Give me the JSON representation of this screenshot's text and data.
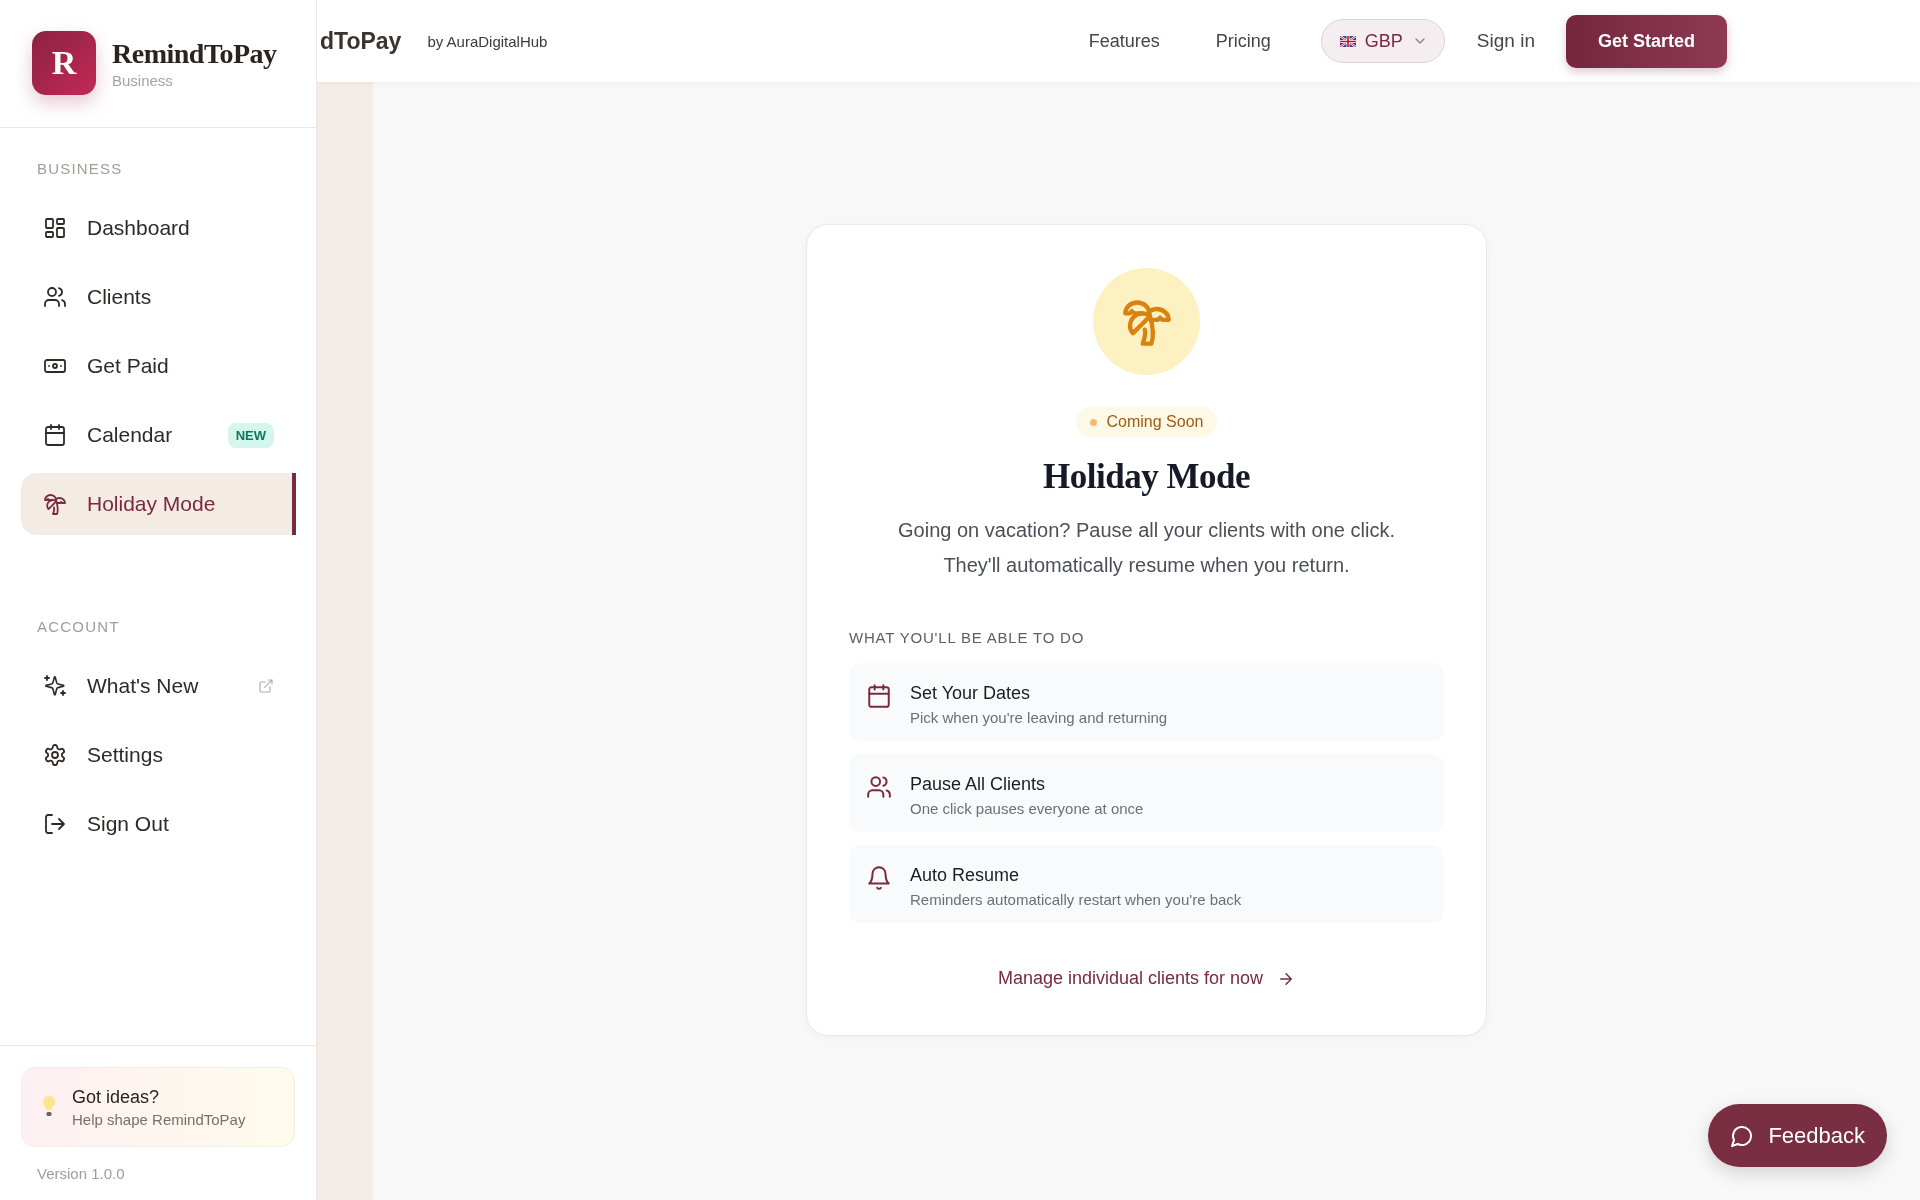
{
  "brand": {
    "logo_letter": "R",
    "name": "RemindToPay",
    "subtitle": "Business"
  },
  "sidebar": {
    "sections": [
      {
        "title": "BUSINESS",
        "items": [
          {
            "label": "Dashboard",
            "selected": false
          },
          {
            "label": "Clients",
            "selected": false
          },
          {
            "label": "Get Paid",
            "selected": false
          },
          {
            "label": "Calendar",
            "selected": false,
            "badge": "NEW"
          },
          {
            "label": "Holiday Mode",
            "selected": true
          }
        ]
      },
      {
        "title": "ACCOUNT",
        "items": [
          {
            "label": "What's New",
            "selected": false,
            "external": true
          },
          {
            "label": "Settings",
            "selected": false
          },
          {
            "label": "Sign Out",
            "selected": false
          }
        ]
      }
    ],
    "ideas": {
      "title": "Got ideas?",
      "subtitle": "Help shape RemindToPay"
    },
    "version": "Version 1.0.0"
  },
  "header": {
    "brand_fragment": "dToPay",
    "byline": "by AuraDigitalHub",
    "nav": [
      "Features",
      "Pricing"
    ],
    "currency": "GBP",
    "sign_in": "Sign in",
    "cta": "Get Started"
  },
  "card": {
    "badge": "Coming Soon",
    "title": "Holiday Mode",
    "description": "Going on vacation? Pause all your clients with one click. They'll automatically resume when you return.",
    "features_heading": "WHAT YOU'LL BE ABLE TO DO",
    "features": [
      {
        "title": "Set Your Dates",
        "subtitle": "Pick when you're leaving and returning"
      },
      {
        "title": "Pause All Clients",
        "subtitle": "One click pauses everyone at once"
      },
      {
        "title": "Auto Resume",
        "subtitle": "Reminders automatically restart when you're back"
      }
    ],
    "link": "Manage individual clients for now"
  },
  "feedback": {
    "label": "Feedback"
  }
}
